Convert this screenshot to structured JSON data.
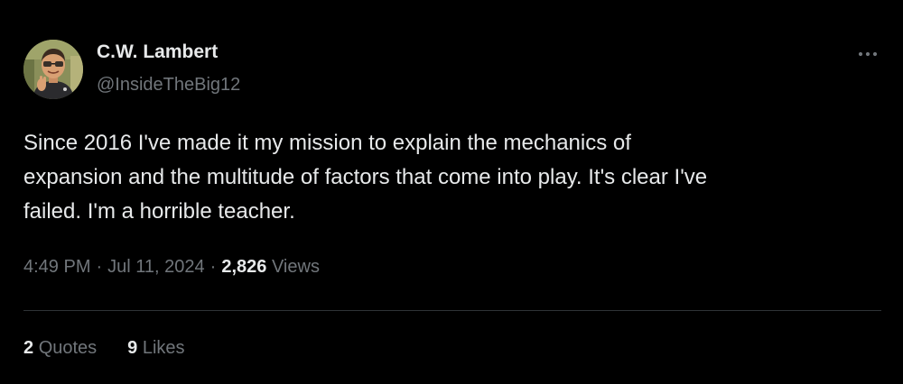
{
  "colors": {
    "background": "#000000",
    "primary_text": "#e7e9ea",
    "secondary_text": "#71767b",
    "divider": "#2f3336"
  },
  "author": {
    "display_name": "C.W. Lambert",
    "handle": "@InsideTheBig12",
    "avatar_icon": "memoji-avatar-icon"
  },
  "more_icon": "more-horizontal-icon",
  "tweet": {
    "text": "Since 2016 I've made it my mission to explain the mechanics of\nexpansion and the multitude of factors that come into play. It's clear I've\nfailed. I'm a horrible teacher."
  },
  "meta": {
    "time": "4:49 PM",
    "separator": "·",
    "date": "Jul 11, 2024",
    "views_count": "2,826",
    "views_label": "Views"
  },
  "stats": {
    "quotes_count": "2",
    "quotes_label": "Quotes",
    "likes_count": "9",
    "likes_label": "Likes"
  }
}
